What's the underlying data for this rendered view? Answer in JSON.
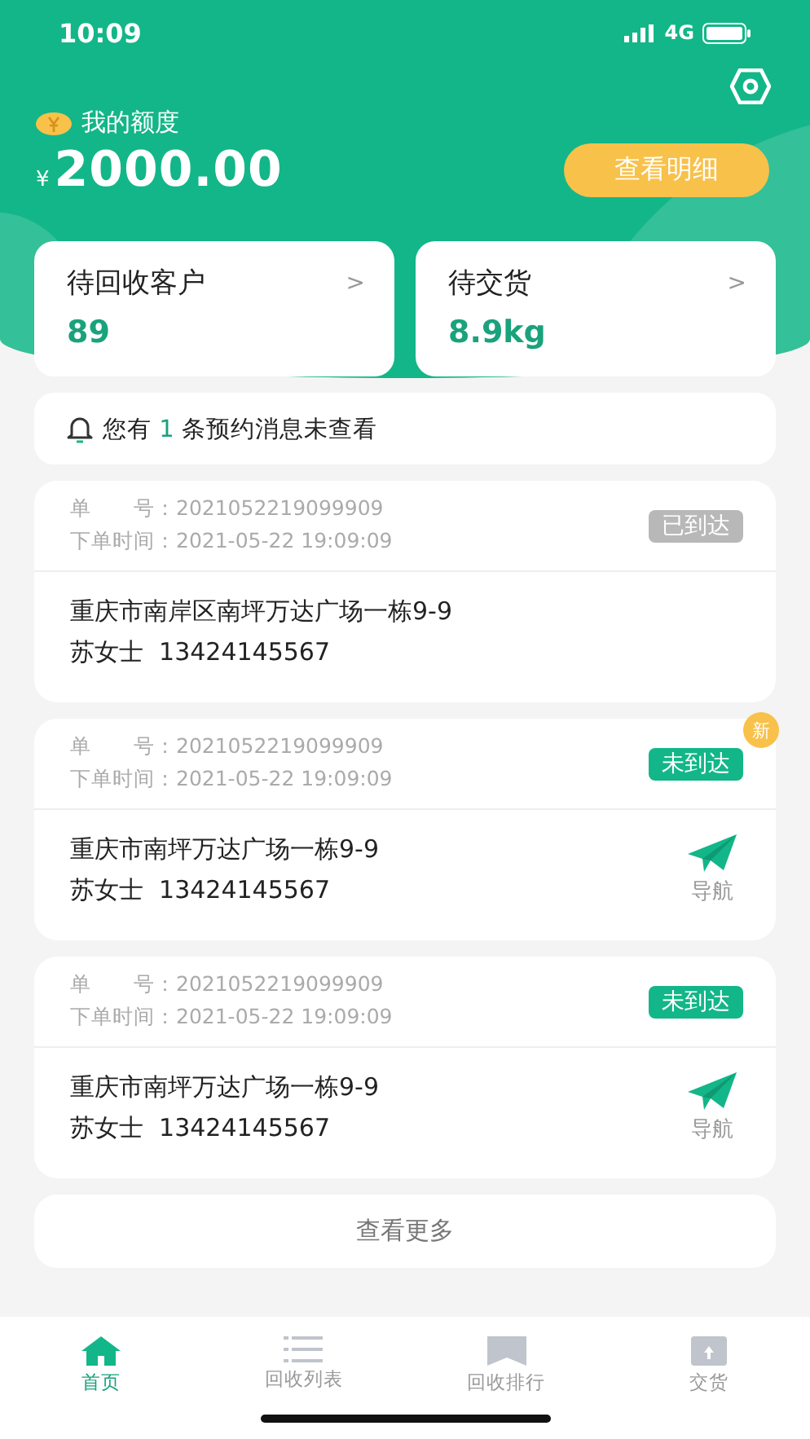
{
  "status_bar": {
    "time": "10:09",
    "network": "4G"
  },
  "balance": {
    "label": "我的额度",
    "currency": "¥",
    "amount": "2000.00",
    "detail_button": "查看明细"
  },
  "stats": [
    {
      "label": "待回收客户",
      "value": "89",
      "chevron": ">"
    },
    {
      "label": "待交货",
      "value": "8.9kg",
      "chevron": ">"
    }
  ],
  "notice": {
    "prefix": "您有",
    "count": "1",
    "suffix": "条预约消息未查看"
  },
  "orders": [
    {
      "number_label": "单　　号：",
      "number": "2021052219099909",
      "time_label": "下单时间：",
      "time": "2021-05-22 19:09:09",
      "status": "已到达",
      "arrived": true,
      "address": "重庆市南岸区南坪万达广场一栋9-9",
      "contact": "苏女士",
      "phone": "13424145567"
    },
    {
      "number_label": "单　　号：",
      "number": "2021052219099909",
      "time_label": "下单时间：",
      "time": "2021-05-22 19:09:09",
      "status": "未到达",
      "arrived": false,
      "badge": "新",
      "address": "重庆市南坪万达广场一栋9-9",
      "contact": "苏女士",
      "phone": "13424145567",
      "nav_label": "导航"
    },
    {
      "number_label": "单　　号：",
      "number": "2021052219099909",
      "time_label": "下单时间：",
      "time": "2021-05-22 19:09:09",
      "status": "未到达",
      "arrived": false,
      "address": "重庆市南坪万达广场一栋9-9",
      "contact": "苏女士",
      "phone": "13424145567",
      "nav_label": "导航"
    }
  ],
  "more_button": "查看更多",
  "tabs": [
    {
      "label": "首页",
      "kind": "home",
      "selected": true
    },
    {
      "label": "回收列表",
      "kind": "list",
      "selected": false
    },
    {
      "label": "回收排行",
      "kind": "rank",
      "selected": false
    },
    {
      "label": "交货",
      "kind": "box",
      "selected": false
    }
  ]
}
